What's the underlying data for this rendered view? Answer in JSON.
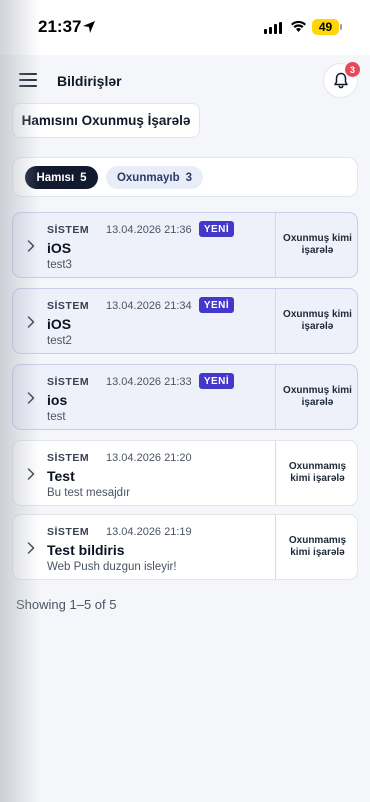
{
  "status_bar": {
    "time": "21:37",
    "battery": "49"
  },
  "header": {
    "title": "Bildirişlər",
    "bell_badge": "3"
  },
  "mark_all_label": "Hamısını Oxunmuş İşarələ",
  "filters": {
    "all": {
      "label": "Hamısı",
      "count": "5"
    },
    "unread": {
      "label": "Oxunmayıb",
      "count": "3"
    }
  },
  "notifications": [
    {
      "source": "SİSTEM",
      "time": "13.04.2026 21:36",
      "badge": "YENİ",
      "title": "iOS",
      "body": "test3",
      "action": "Oxunmuş kimi işarələ",
      "unread": true
    },
    {
      "source": "SİSTEM",
      "time": "13.04.2026 21:34",
      "badge": "YENİ",
      "title": "iOS",
      "body": "test2",
      "action": "Oxunmuş kimi işarələ",
      "unread": true
    },
    {
      "source": "SİSTEM",
      "time": "13.04.2026 21:33",
      "badge": "YENİ",
      "title": "ios",
      "body": "test",
      "action": "Oxunmuş kimi işarələ",
      "unread": true
    },
    {
      "source": "SİSTEM",
      "time": "13.04.2026 21:20",
      "badge": "",
      "title": "Test",
      "body": "Bu test mesajdır",
      "action": "Oxunmamış kimi işarələ",
      "unread": false
    },
    {
      "source": "SİSTEM",
      "time": "13.04.2026 21:19",
      "badge": "",
      "title": "Test bildiris",
      "body": "Web Push duzgun isleyir!",
      "action": "Oxunmamış kimi işarələ",
      "unread": false
    }
  ],
  "pagination_text": "Showing 1–5 of 5",
  "colors": {
    "accent": "#4338ca",
    "badge_red": "#e64a5a",
    "dark_pill": "#111a2e"
  }
}
